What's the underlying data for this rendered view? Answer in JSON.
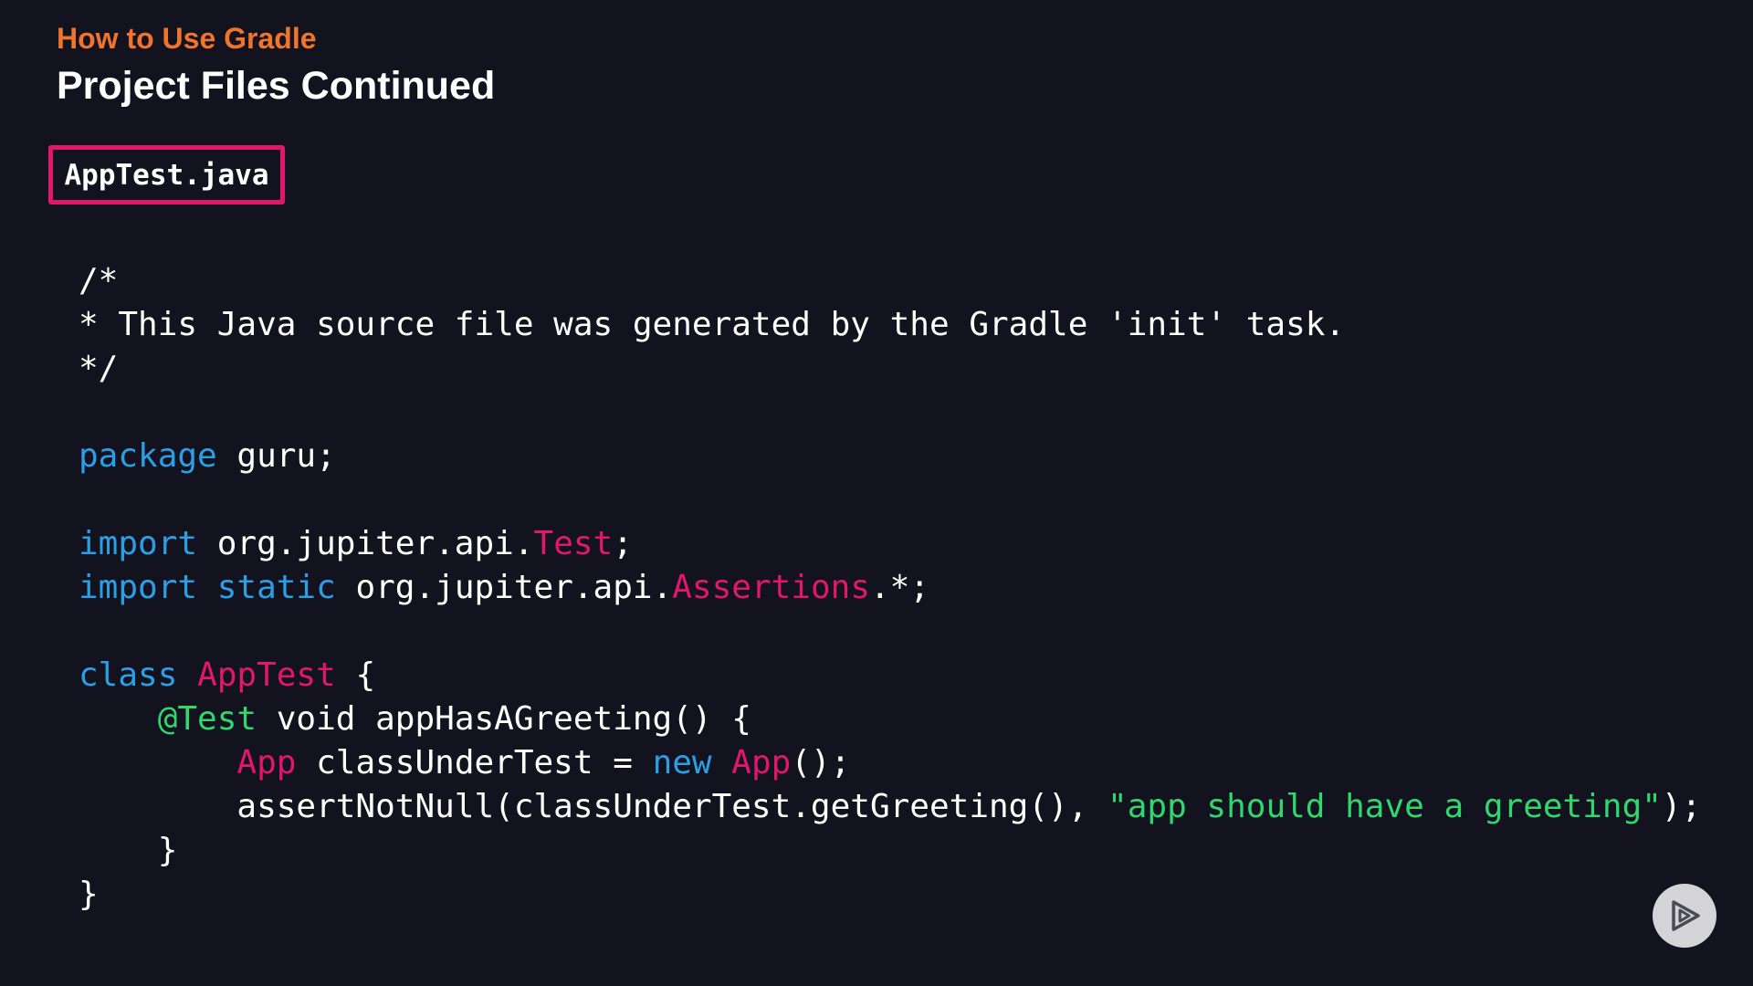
{
  "header": {
    "course_title": "How to Use Gradle",
    "slide_title": "Project Files Continued"
  },
  "file_label": "AppTest.java",
  "code": {
    "lines": [
      [
        {
          "t": "/*",
          "k": "plain"
        }
      ],
      [
        {
          "t": "* This Java source file was generated by the Gradle 'init' task.",
          "k": "plain"
        }
      ],
      [
        {
          "t": "*/",
          "k": "plain"
        }
      ],
      [],
      [
        {
          "t": "package",
          "k": "keyword"
        },
        {
          "t": " guru;",
          "k": "plain"
        }
      ],
      [],
      [
        {
          "t": "import",
          "k": "keyword"
        },
        {
          "t": " org.jupiter.api.",
          "k": "plain"
        },
        {
          "t": "Test",
          "k": "type"
        },
        {
          "t": ";",
          "k": "plain"
        }
      ],
      [
        {
          "t": "import",
          "k": "keyword"
        },
        {
          "t": " ",
          "k": "plain"
        },
        {
          "t": "static",
          "k": "keyword"
        },
        {
          "t": " org.jupiter.api.",
          "k": "plain"
        },
        {
          "t": "Assertions",
          "k": "type"
        },
        {
          "t": ".*;",
          "k": "plain"
        }
      ],
      [],
      [
        {
          "t": "class",
          "k": "keyword"
        },
        {
          "t": " ",
          "k": "plain"
        },
        {
          "t": "AppTest",
          "k": "type"
        },
        {
          "t": " {",
          "k": "plain"
        }
      ],
      [
        {
          "t": "    ",
          "k": "plain"
        },
        {
          "t": "@Test",
          "k": "annotation"
        },
        {
          "t": " void appHasAGreeting() {",
          "k": "plain"
        }
      ],
      [
        {
          "t": "        ",
          "k": "plain"
        },
        {
          "t": "App",
          "k": "type"
        },
        {
          "t": " classUnderTest = ",
          "k": "plain"
        },
        {
          "t": "new",
          "k": "keyword"
        },
        {
          "t": " ",
          "k": "plain"
        },
        {
          "t": "App",
          "k": "type"
        },
        {
          "t": "();",
          "k": "plain"
        }
      ],
      [
        {
          "t": "        assertNotNull(classUnderTest.getGreeting(), ",
          "k": "plain"
        },
        {
          "t": "\"app should have a greeting\"",
          "k": "string"
        },
        {
          "t": ");",
          "k": "plain"
        }
      ],
      [
        {
          "t": "    }",
          "k": "plain"
        }
      ],
      [
        {
          "t": "}",
          "k": "plain"
        }
      ]
    ]
  },
  "colors": {
    "background": "#13121f",
    "course_title": "#f0742d",
    "keyword": "#2a9fe6",
    "type": "#e0176c",
    "annotation": "#2fd76d",
    "string": "#2fd76d",
    "highlight_border": "#e0176c"
  },
  "icons": {
    "play_button": "play-triangle-icon"
  }
}
